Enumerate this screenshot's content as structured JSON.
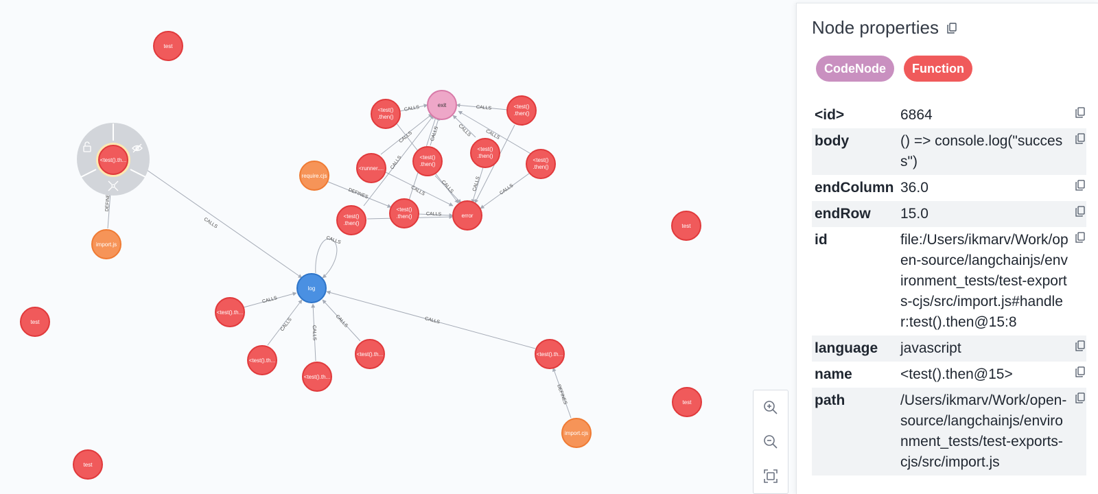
{
  "graph": {
    "node_colors": {
      "Function": "#f05a5b",
      "CodeNode_module": "#f69458",
      "log": "#4a90e2",
      "exit": "#eea7c8"
    },
    "nodes": {
      "test1": {
        "label": "test",
        "kind": "Function"
      },
      "test2": {
        "label": "test",
        "kind": "Function"
      },
      "test3": {
        "label": "test",
        "kind": "Function"
      },
      "test4": {
        "label": "test",
        "kind": "Function"
      },
      "test5": {
        "label": "test",
        "kind": "Function"
      },
      "selected": {
        "label": "<test().th...",
        "kind": "Function"
      },
      "import_js": {
        "label": "import.js",
        "kind": "Module"
      },
      "require_cjs": {
        "label": "require.cjs",
        "kind": "Module"
      },
      "import_cjs": {
        "label": "import.cjs",
        "kind": "Module"
      },
      "log": {
        "label": "log",
        "kind": "Log"
      },
      "exit": {
        "label": "exit",
        "kind": "Exit"
      },
      "error": {
        "label": "error",
        "kind": "Function"
      },
      "runner": {
        "label": "<runner....",
        "kind": "Function"
      },
      "then_a": {
        "label1": "<test()",
        "label2": ".then()"
      },
      "then_b": {
        "label1": "<test()",
        "label2": ".then()"
      },
      "then_c": {
        "label1": "<test()",
        "label2": ".then()"
      },
      "then_d": {
        "label1": "<test()",
        "label2": ".then()"
      },
      "then_e": {
        "label1": "<test()",
        "label2": ".then()"
      },
      "then_f": {
        "label1": "<test()",
        "label2": ".then()"
      },
      "then_g": {
        "label1": "<test()",
        "label2": ".then()"
      },
      "th_1": {
        "label": "<test().th..."
      },
      "th_2": {
        "label": "<test().th..."
      },
      "th_3": {
        "label": "<test().th..."
      },
      "th_4": {
        "label": "<test().th..."
      },
      "th_5": {
        "label": "<test().th..."
      }
    },
    "rel_labels": {
      "calls": "CALLS",
      "defines": "DEFINES"
    }
  },
  "zoom": {
    "zoom_in": "zoom-in-icon",
    "zoom_out": "zoom-out-icon",
    "fit": "fit-screen-icon"
  },
  "panel": {
    "title": "Node properties",
    "badges": [
      {
        "label": "CodeNode",
        "color": "#c990c0"
      },
      {
        "label": "Function",
        "color": "#f05a5b"
      }
    ],
    "properties": [
      {
        "key": "<id>",
        "value": "6864"
      },
      {
        "key": "body",
        "value": "() => console.log(\"success\")"
      },
      {
        "key": "endColumn",
        "value": "36.0"
      },
      {
        "key": "endRow",
        "value": "15.0"
      },
      {
        "key": "id",
        "value": "file:/Users/ikmarv/Work/open-source/langchainjs/environment_tests/test-exports-cjs/src/import.js#handler:test().then@15:8"
      },
      {
        "key": "language",
        "value": "javascript"
      },
      {
        "key": "name",
        "value": "<test().then@15>"
      },
      {
        "key": "path",
        "value": "/Users/ikmarv/Work/open-source/langchainjs/environment_tests/test-exports-cjs/src/import.js"
      }
    ]
  }
}
